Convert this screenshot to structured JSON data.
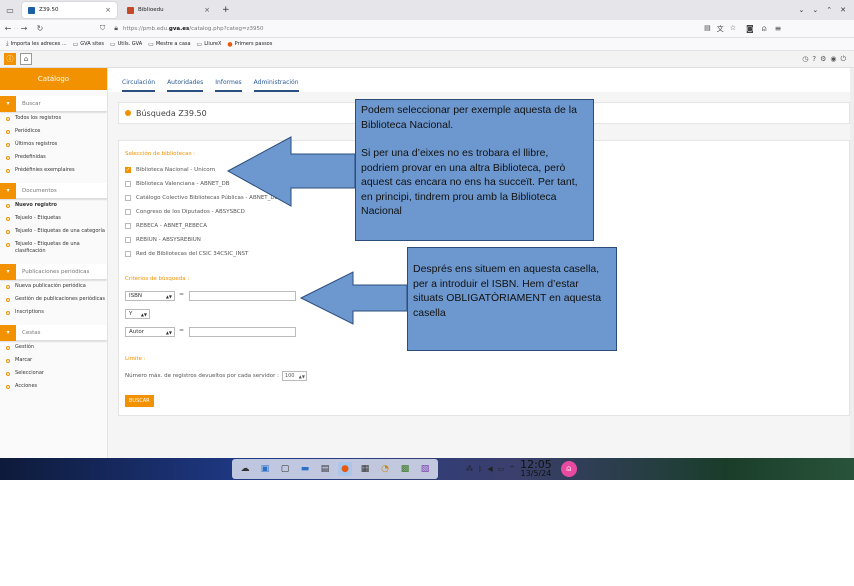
{
  "browser": {
    "tabs": [
      {
        "label": "Z39.50",
        "active": true
      },
      {
        "label": "Biblioedu",
        "active": false
      }
    ],
    "url_prefix": "https://pmb.edu.",
    "url_domain": "gva.es",
    "url_suffix": "/catalog.php?categ=z3950",
    "bookmarks": [
      "Importa les adreces ...",
      "GVA sites",
      "Utils. GVA",
      "Mestre a casa",
      "LliureX",
      "Primers passos"
    ]
  },
  "sidebar": {
    "catalog_title": "Catálogo",
    "sections": [
      {
        "title": "Buscar",
        "items": [
          "Todos los registros",
          "Periódicos",
          "Últimos registros",
          "Predefinidas",
          "Prédéfinies exemplaires"
        ]
      },
      {
        "title": "Documentos",
        "items": [
          "Nuevo registro",
          "Tejuelo - Etiquetas",
          "Tejuelo - Etiquetas de una categoría",
          "Tejuelo - Etiquetas de una clasificación"
        ]
      },
      {
        "title": "Publicaciones periódicas",
        "items": [
          "Nueva publicación periódica",
          "Gestión de publicaciones periódicas",
          "Inscriptions"
        ]
      },
      {
        "title": "Cestas",
        "items": [
          "Gestión",
          "Marcar",
          "Seleccionar",
          "Acciones"
        ]
      }
    ]
  },
  "topnav": [
    "Circulación",
    "Autoridades",
    "Informes",
    "Administración"
  ],
  "main": {
    "title": "Búsqueda Z39.50",
    "libs_label": "Selección de bibliotecas :",
    "libraries": [
      {
        "name": "Biblioteca Nacional - Unicorn",
        "checked": true
      },
      {
        "name": "Biblioteca Valenciana - ABNET_DB",
        "checked": false
      },
      {
        "name": "Catálogo Colectivo Bibliotecas Públicas - ABNET_DB",
        "checked": false
      },
      {
        "name": "Congreso de los Diputados - ABSYSBCD",
        "checked": false
      },
      {
        "name": "REBECA - ABNET_REBECA",
        "checked": false
      },
      {
        "name": "REBIUN - ABSYSREBIUN",
        "checked": false
      },
      {
        "name": "Red de Bibliotecas del CSIC  34CSIC_INST",
        "checked": false
      }
    ],
    "criteria_label": "Criterios de búsqueda :",
    "criteria1": "ISBN",
    "operator": "Y",
    "criteria2": "Autor",
    "eq": "=",
    "limit_label": "Límite :",
    "max_label": "Número máx. de registros devueltos por cada servidor :",
    "max_value": "100",
    "search_button": "BUSCAR"
  },
  "callouts": {
    "first": [
      "Podem seleccionar per exemple aquesta de la Biblioteca Nacional.",
      "",
      "Si per una d’eixes no es trobara el llibre, podriem provar en una altra Biblioteca, però aquest cas encara no ens ha succeït. Per tant, en principi, tindrem prou amb la Biblioteca Nacional"
    ],
    "second": "Després ens situem en aquesta casella, per a introduir el ISBN. Hem d’estar situats OBLIGATÒRIAMENT en aquesta casella",
    "fill_color": "#6d98cf",
    "border_color": "#2c4d7c"
  },
  "taskbar": {
    "time": "12:05",
    "date": "13/5/24"
  },
  "colors": {
    "accent": "#f39200",
    "nav_blue": "#2a5b94"
  }
}
